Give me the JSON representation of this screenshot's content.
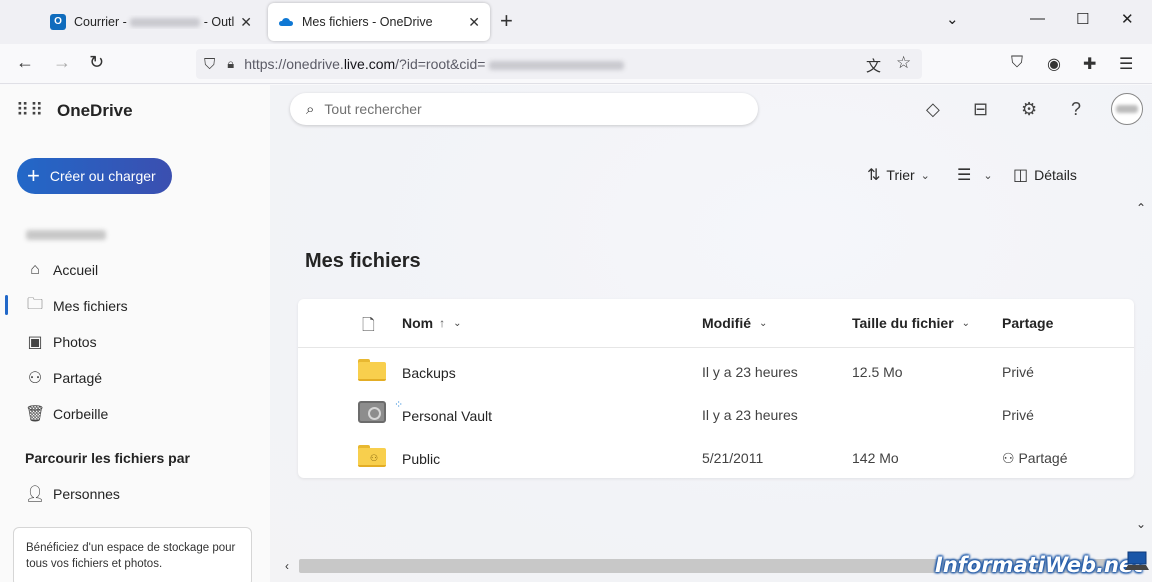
{
  "browser": {
    "tabs": [
      {
        "title_prefix": "Courrier - ",
        "title_suffix": "Outloo",
        "active": false
      },
      {
        "title": "Mes fichiers - OneDrive",
        "active": true
      }
    ],
    "url": {
      "prefix": "https://onedrive.",
      "host": "live.com",
      "suffix": "/?id=root&cid="
    }
  },
  "app": {
    "brand": "OneDrive",
    "search_placeholder": "Tout rechercher",
    "create_label": "Créer ou charger",
    "nav": [
      {
        "label": "Accueil",
        "icon": "home-icon"
      },
      {
        "label": "Mes fichiers",
        "icon": "folder-icon",
        "selected": true
      },
      {
        "label": "Photos",
        "icon": "image-icon"
      },
      {
        "label": "Partagé",
        "icon": "people-icon"
      },
      {
        "label": "Corbeille",
        "icon": "recycle-bin-icon"
      }
    ],
    "browse_heading": "Parcourir les fichiers par",
    "people_label": "Personnes",
    "promo_text": "Bénéficiez d'un espace de stockage pour tous vos fichiers et photos.",
    "commands": {
      "sort": "Trier",
      "details": "Détails"
    },
    "page_title": "Mes fichiers",
    "columns": {
      "name": "Nom",
      "modified": "Modifié",
      "size": "Taille du fichier",
      "sharing": "Partage"
    },
    "files": [
      {
        "name": "Backups",
        "modified": "Il y a 23 heures",
        "size": "12.5 Mo",
        "sharing": "Privé",
        "type": "folder"
      },
      {
        "name": "Personal Vault",
        "modified": "Il y a 23 heures",
        "size": "",
        "sharing": "Privé",
        "type": "vault"
      },
      {
        "name": "Public",
        "modified": "5/21/2011",
        "size": "142 Mo",
        "sharing": "Partagé",
        "type": "shared-folder"
      }
    ]
  },
  "watermark": "InformatiWeb.net",
  "colors": {
    "accent": "#2268c8",
    "folder": "#f8cf4d"
  }
}
